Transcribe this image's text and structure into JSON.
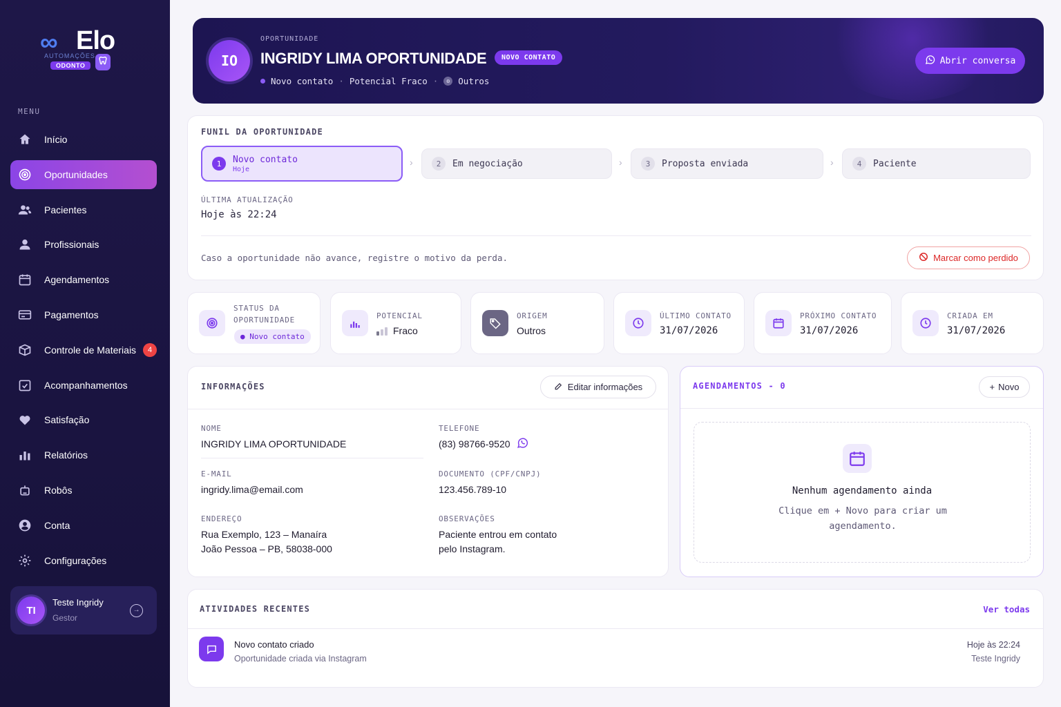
{
  "brand": {
    "name": "Elo",
    "infinity": "∞",
    "sub": "AUTOMAÇÕES",
    "badge": "ODONTO",
    "tooth": "🦷"
  },
  "sidebar": {
    "menu_label": "MENU",
    "items": [
      {
        "label": "Início",
        "icon": "home-icon"
      },
      {
        "label": "Oportunidades",
        "icon": "target-icon",
        "active": true
      },
      {
        "label": "Pacientes",
        "icon": "users-icon"
      },
      {
        "label": "Profissionais",
        "icon": "user-icon"
      },
      {
        "label": "Agendamentos",
        "icon": "calendar-icon"
      },
      {
        "label": "Pagamentos",
        "icon": "card-icon"
      },
      {
        "label": "Controle de Materiais",
        "icon": "box-icon",
        "badge": "4"
      },
      {
        "label": "Acompanhamentos",
        "icon": "check-icon"
      },
      {
        "label": "Satisfação",
        "icon": "heart-icon"
      },
      {
        "label": "Relatórios",
        "icon": "chart-icon"
      },
      {
        "label": "Robôs",
        "icon": "robot-icon"
      },
      {
        "label": "Conta",
        "icon": "account-icon"
      },
      {
        "label": "Configurações",
        "icon": "gear-icon"
      }
    ],
    "user": {
      "initials": "TI",
      "name": "Teste Ingridy",
      "role": "Gestor"
    }
  },
  "hero": {
    "kicker": "OPORTUNIDADE",
    "initials": "IO",
    "title": "INGRIDY LIMA OPORTUNIDADE",
    "pill": "NOVO CONTATO",
    "meta_stage": "Novo contato",
    "meta_potential": "Potencial Fraco",
    "meta_origin": "Outros",
    "button": "Abrir conversa"
  },
  "funnel": {
    "title": "FUNIL DA OPORTUNIDADE",
    "steps": [
      {
        "num": "1",
        "label": "Novo contato",
        "sub": "Hoje"
      },
      {
        "num": "2",
        "label": "Em negociação"
      },
      {
        "num": "3",
        "label": "Proposta enviada"
      },
      {
        "num": "4",
        "label": "Paciente"
      }
    ],
    "update_label": "ÚLTIMA ATUALIZAÇÃO",
    "update_value": "Hoje às 22:24",
    "loss_text": "Caso a oportunidade não avance, registre o motivo da perda.",
    "loss_button": "Marcar como perdido"
  },
  "stats": {
    "status": {
      "label1": "STATUS DA",
      "label2": "OPORTUNIDADE",
      "value": "Novo contato"
    },
    "potencial": {
      "label": "POTENCIAL",
      "value": "Fraco"
    },
    "origem": {
      "label": "ORIGEM",
      "value": "Outros"
    },
    "ultimo": {
      "label": "ÚLTIMO CONTATO",
      "value": "31/07/2026"
    },
    "proximo": {
      "label": "PRÓXIMO CONTATO",
      "value": "31/07/2026"
    },
    "criada": {
      "label": "CRIADA EM",
      "value": "31/07/2026"
    }
  },
  "info": {
    "title": "INFORMAÇÕES",
    "edit_button": "Editar informações",
    "nome_label": "NOME",
    "nome": "INGRIDY LIMA OPORTUNIDADE",
    "telefone_label": "TELEFONE",
    "telefone": "(83) 98766-9520",
    "email_label": "E-MAIL",
    "email": "ingridy.lima@email.com",
    "documento_label": "DOCUMENTO (CPF/CNPJ)",
    "documento": "123.456.789-10",
    "endereco_label": "ENDEREÇO",
    "endereco1": "Rua Exemplo, 123 – Manaíra",
    "endereco2": "João Pessoa – PB, 58038-000",
    "obs_label": "OBSERVAÇÕES",
    "obs1": "Paciente entrou em contato",
    "obs2": "pelo Instagram."
  },
  "appointments": {
    "title": "AGENDAMENTOS - 0",
    "new_button": "Novo",
    "empty_title": "Nenhum agendamento ainda",
    "empty_sub": "Clique em + Novo para criar um agendamento."
  },
  "activities": {
    "title": "ATIVIDADES RECENTES",
    "see_all": "Ver todas",
    "items": [
      {
        "title": "Novo contato criado",
        "sub": "Oportunidade criada via Instagram",
        "time": "Hoje às 22:24",
        "user": "Teste Ingridy"
      }
    ]
  },
  "colors": {
    "accent": "#7c3aed",
    "sidebar": "#1e1748",
    "danger": "#dc2626"
  }
}
